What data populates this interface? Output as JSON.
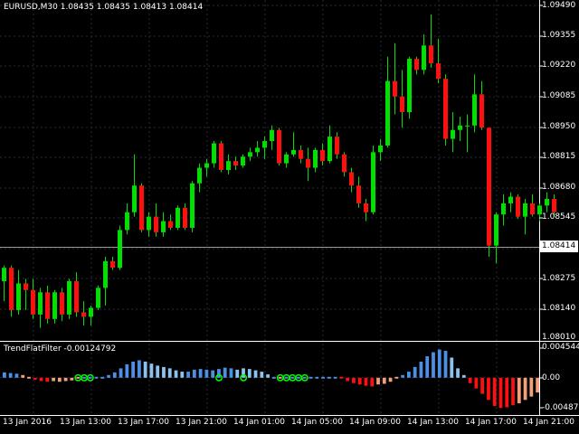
{
  "chart_header": {
    "symbol_text": "EURUSD,M30",
    "ohlc_text": "1.08435 1.08435 1.08413 1.08414"
  },
  "indicator_header": {
    "name": "TrendFlatFilter",
    "value": "-0.00124792"
  },
  "current_price": "1.08414",
  "price_axis_labels": [
    "1.09490",
    "1.09355",
    "1.09220",
    "1.09085",
    "1.08950",
    "1.08815",
    "1.08680",
    "1.08545",
    "1.08275",
    "1.08140",
    "1.08010"
  ],
  "indicator_axis_labels": [
    "0.004544",
    "0.00",
    "-0.004873"
  ],
  "time_axis_labels": [
    "13 Jan 2016",
    "13 Jan 13:00",
    "13 Jan 17:00",
    "13 Jan 21:00",
    "14 Jan 01:00",
    "14 Jan 05:00",
    "14 Jan 09:00",
    "14 Jan 13:00",
    "14 Jan 17:00",
    "14 Jan 21:00"
  ],
  "colors": {
    "background": "#000000",
    "grid": "#2a2a3a",
    "bull": "#00e000",
    "bear": "#ff1010",
    "wick": "#00e000",
    "hist_blue": "#4e8fe6",
    "hist_lightblue": "#8ec2ee",
    "hist_red": "#ff1010",
    "hist_salmon": "#f4a07a",
    "flat_marker": "#00ff00",
    "axis_text": "#ffffff"
  },
  "chart_data": [
    {
      "type": "candlestick",
      "symbol": "EURUSD",
      "timeframe": "M30",
      "ylim": [
        1.0801,
        1.0949
      ],
      "candles": [
        [
          1.0825,
          1.0832,
          1.0816,
          1.0831
        ],
        [
          1.0831,
          1.0832,
          1.0809,
          1.0812
        ],
        [
          1.0812,
          1.083,
          1.081,
          1.0824
        ],
        [
          1.0824,
          1.0826,
          1.0812,
          1.0821
        ],
        [
          1.0821,
          1.0826,
          1.0808,
          1.081
        ],
        [
          1.081,
          1.0822,
          1.0804,
          1.082
        ],
        [
          1.082,
          1.0823,
          1.0806,
          1.0808
        ],
        [
          1.0808,
          1.0821,
          1.0806,
          1.082
        ],
        [
          1.082,
          1.0822,
          1.0807,
          1.081
        ],
        [
          1.081,
          1.0826,
          1.0808,
          1.0825
        ],
        [
          1.0825,
          1.0829,
          1.0809,
          1.0811
        ],
        [
          1.0811,
          1.0816,
          1.0805,
          1.0809
        ],
        [
          1.0809,
          1.0814,
          1.0805,
          1.0813
        ],
        [
          1.0813,
          1.0823,
          1.0812,
          1.0822
        ],
        [
          1.0822,
          1.0836,
          1.0814,
          1.0834
        ],
        [
          1.0834,
          1.0836,
          1.083,
          1.0831
        ],
        [
          1.0831,
          1.085,
          1.083,
          1.0848
        ],
        [
          1.0848,
          1.086,
          1.0846,
          1.0856
        ],
        [
          1.0856,
          1.0882,
          1.0854,
          1.0868
        ],
        [
          1.0868,
          1.0869,
          1.0847,
          1.0848
        ],
        [
          1.0848,
          1.0856,
          1.0845,
          1.0854
        ],
        [
          1.0854,
          1.086,
          1.0845,
          1.0847
        ],
        [
          1.0847,
          1.0856,
          1.0845,
          1.0852
        ],
        [
          1.0852,
          1.0855,
          1.0848,
          1.0849
        ],
        [
          1.0849,
          1.0859,
          1.0848,
          1.0858
        ],
        [
          1.0858,
          1.086,
          1.0848,
          1.0849
        ],
        [
          1.0849,
          1.087,
          1.0847,
          1.0869
        ],
        [
          1.0869,
          1.0878,
          1.0865,
          1.0876
        ],
        [
          1.0876,
          1.088,
          1.0872,
          1.0878
        ],
        [
          1.0878,
          1.0888,
          1.0876,
          1.0887
        ],
        [
          1.0887,
          1.0888,
          1.0874,
          1.0875
        ],
        [
          1.0875,
          1.0882,
          1.0873,
          1.0879
        ],
        [
          1.0879,
          1.0881,
          1.0875,
          1.0877
        ],
        [
          1.0877,
          1.0882,
          1.0876,
          1.0881
        ],
        [
          1.0881,
          1.0885,
          1.0879,
          1.0883
        ],
        [
          1.0883,
          1.0888,
          1.0881,
          1.0885
        ],
        [
          1.0885,
          1.089,
          1.088,
          1.0888
        ],
        [
          1.0888,
          1.0895,
          1.0884,
          1.0893
        ],
        [
          1.0893,
          1.0894,
          1.0877,
          1.0878
        ],
        [
          1.0878,
          1.0883,
          1.0876,
          1.0882
        ],
        [
          1.0882,
          1.0892,
          1.0881,
          1.0884
        ],
        [
          1.0884,
          1.0886,
          1.0878,
          1.088
        ],
        [
          1.088,
          1.0885,
          1.087,
          1.0876
        ],
        [
          1.0876,
          1.0885,
          1.0874,
          1.0884
        ],
        [
          1.0884,
          1.0887,
          1.0877,
          1.0879
        ],
        [
          1.0879,
          1.0895,
          1.0878,
          1.089
        ],
        [
          1.089,
          1.0892,
          1.088,
          1.0882
        ],
        [
          1.0882,
          1.0883,
          1.0872,
          1.0874
        ],
        [
          1.0874,
          1.0876,
          1.0865,
          1.0868
        ],
        [
          1.0868,
          1.0872,
          1.0858,
          1.086
        ],
        [
          1.086,
          1.0862,
          1.0852,
          1.0856
        ],
        [
          1.0856,
          1.0886,
          1.0855,
          1.0883
        ],
        [
          1.0883,
          1.0889,
          1.0879,
          1.0886
        ],
        [
          1.0886,
          1.0926,
          1.0885,
          1.0915
        ],
        [
          1.0915,
          1.0932,
          1.09,
          1.0908
        ],
        [
          1.0908,
          1.092,
          1.0894,
          1.0901
        ],
        [
          1.0901,
          1.0926,
          1.0898,
          1.0925
        ],
        [
          1.0925,
          1.0926,
          1.0918,
          1.092
        ],
        [
          1.092,
          1.0936,
          1.0918,
          1.0931
        ],
        [
          1.0931,
          1.0945,
          1.0921,
          1.0923
        ],
        [
          1.0923,
          1.0934,
          1.0914,
          1.0916
        ],
        [
          1.0916,
          1.0918,
          1.0886,
          1.0889
        ],
        [
          1.0889,
          1.0901,
          1.0883,
          1.0893
        ],
        [
          1.0893,
          1.0899,
          1.0888,
          1.0895
        ],
        [
          1.0895,
          1.09,
          1.0883,
          1.0895
        ],
        [
          1.0895,
          1.0918,
          1.0892,
          1.0909
        ],
        [
          1.0909,
          1.0915,
          1.0893,
          1.0894
        ],
        [
          1.0894,
          1.0894,
          1.0836,
          1.0841
        ],
        [
          1.0841,
          1.0856,
          1.0833,
          1.0855
        ],
        [
          1.0855,
          1.0864,
          1.085,
          1.086
        ],
        [
          1.086,
          1.0865,
          1.0856,
          1.0863
        ],
        [
          1.0863,
          1.0864,
          1.0853,
          1.0854
        ],
        [
          1.0854,
          1.0862,
          1.0846,
          1.086
        ],
        [
          1.086,
          1.0864,
          1.0854,
          1.0855
        ],
        [
          1.0855,
          1.086,
          1.0852,
          1.0859
        ],
        [
          1.0859,
          1.0865,
          1.0856,
          1.0862
        ],
        [
          1.0862,
          1.0864,
          1.0854,
          1.0856
        ]
      ]
    },
    {
      "type": "bar",
      "title": "TrendFlatFilter",
      "ylim": [
        -0.004873,
        0.004544
      ],
      "values": [
        0.0008,
        0.0007,
        0.0006,
        0.0004,
        0.0001,
        -0.0003,
        -0.0005,
        -0.0006,
        -0.0005,
        -0.0006,
        -0.0005,
        -0.0004,
        -0.0002,
        0,
        0,
        0,
        0.0002,
        0.0004,
        0.0008,
        0.0014,
        0.002,
        0.0024,
        0.0026,
        0.0024,
        0.0021,
        0.0018,
        0.0016,
        0.0014,
        0.0011,
        0.0009,
        0.0009,
        0.0012,
        0.0013,
        0.0012,
        0.0011,
        0.0013,
        0.0015,
        0.0014,
        0.0012,
        0.0014,
        0.0013,
        0.0011,
        0.0009,
        0.0005,
        0,
        -0.0002,
        0,
        0,
        0,
        0,
        0,
        0,
        0,
        0,
        0,
        -0.0002,
        -0.0005,
        -0.0008,
        -0.001,
        -0.0012,
        -0.0013,
        -0.001,
        -0.0009,
        -0.0006,
        -0.0002,
        0.0004,
        0.0009,
        0.0016,
        0.0024,
        0.0032,
        0.0038,
        0.0042,
        0.004,
        0.003,
        0.0014,
        0.0004,
        -0.0008,
        -0.0016,
        -0.0024,
        -0.0033,
        -0.0042,
        -0.0045,
        -0.0044,
        -0.0041,
        -0.0038,
        -0.0033,
        -0.0028,
        -0.0022
      ],
      "color_class": [
        "b",
        "b",
        "b",
        "s",
        "s",
        "r",
        "r",
        "r",
        "s",
        "s",
        "s",
        "s",
        "s",
        "z",
        "z",
        "z",
        "b",
        "b",
        "b",
        "b",
        "b",
        "b",
        "b",
        "l",
        "l",
        "l",
        "l",
        "l",
        "l",
        "l",
        "b",
        "b",
        "b",
        "b",
        "b",
        "b",
        "b",
        "b",
        "l",
        "l",
        "l",
        "l",
        "l",
        "l",
        "z",
        "s",
        "z",
        "z",
        "z",
        "z",
        "z",
        "z",
        "z",
        "z",
        "z",
        "r",
        "r",
        "r",
        "r",
        "r",
        "r",
        "s",
        "s",
        "s",
        "s",
        "b",
        "b",
        "b",
        "b",
        "b",
        "b",
        "b",
        "b",
        "l",
        "l",
        "l",
        "r",
        "r",
        "r",
        "r",
        "r",
        "r",
        "r",
        "r",
        "s",
        "s",
        "s",
        "s"
      ],
      "flat_markers_at": [
        12,
        13,
        14,
        35,
        39,
        45,
        46,
        47,
        48,
        49
      ]
    }
  ]
}
